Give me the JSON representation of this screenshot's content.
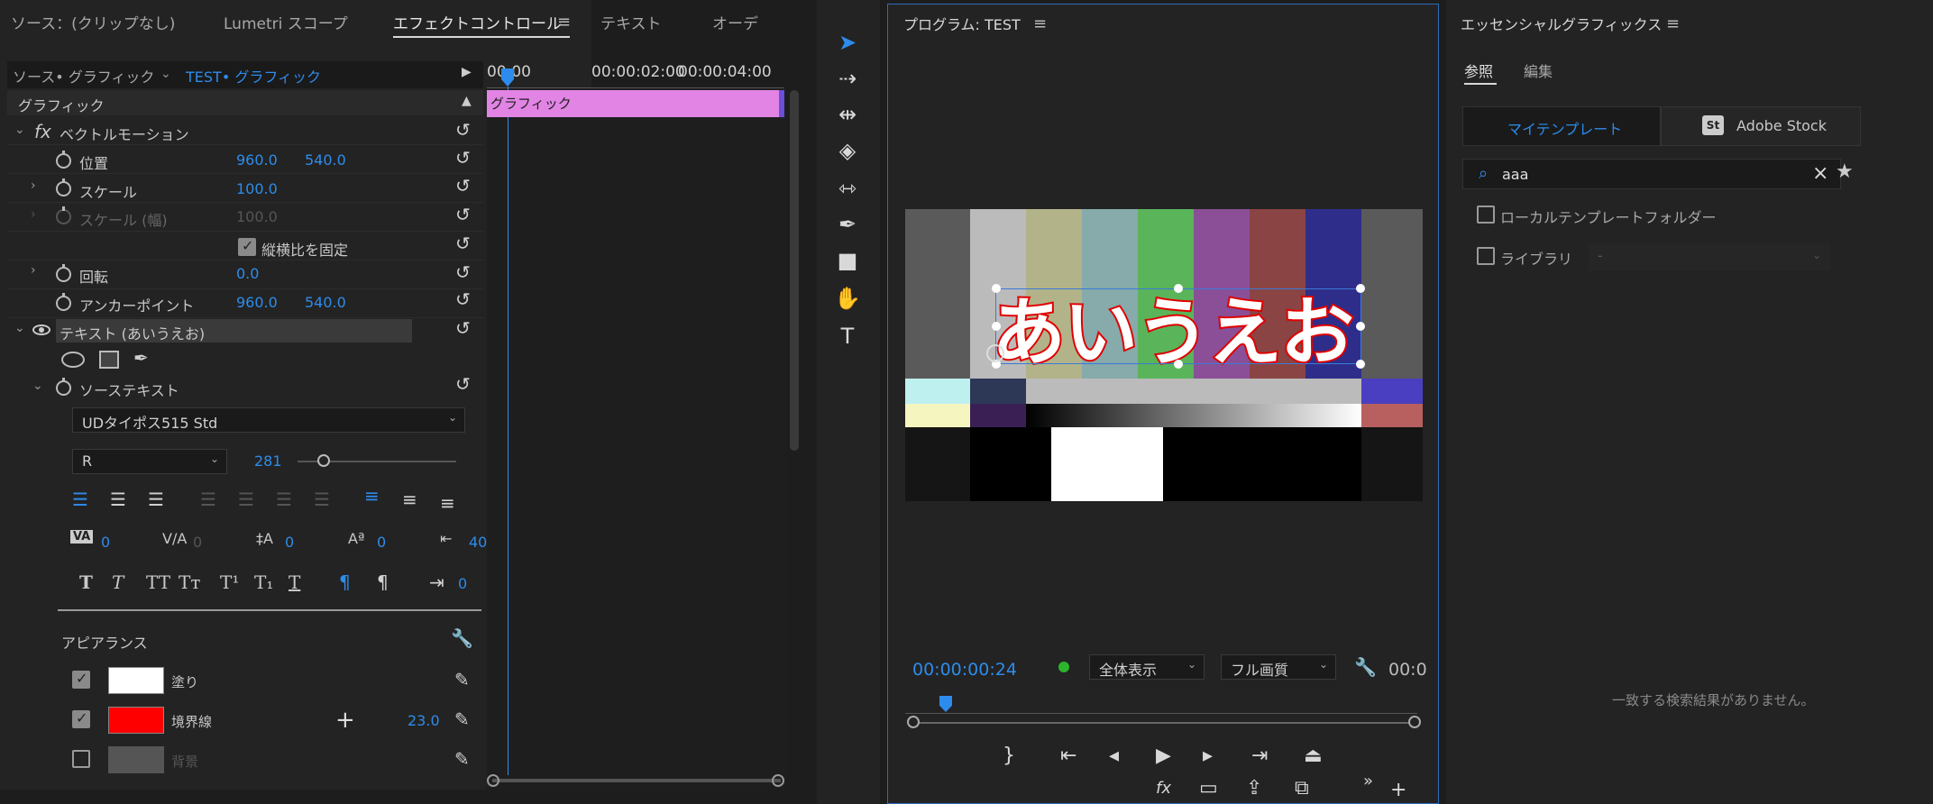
{
  "left_tabs": [
    "ソース：(クリップなし)",
    "Lumetri スコープ",
    "エフェクトコントロール",
    "テキスト",
    "オーデ"
  ],
  "source_bar": {
    "source": "ソース• グラフィック",
    "sequence": "TEST• グラフィック"
  },
  "timecodes": [
    "00:00",
    "00:00:02:00",
    "00:00:04:00"
  ],
  "clip_label": "グラフィック",
  "graphic_header": "グラフィック",
  "vector_motion": {
    "fx": "fx",
    "label": "ベクトルモーション",
    "position_label": "位置",
    "position_x": "960.0",
    "position_y": "540.0",
    "scale_label": "スケール",
    "scale_value": "100.0",
    "scale_w_label": "スケール (幅)",
    "scale_w_value": "100.0",
    "uniform_label": "縦横比を固定",
    "rotation_label": "回転",
    "rotation_value": "0.0",
    "anchor_label": "アンカーポイント",
    "anchor_x": "960.0",
    "anchor_y": "540.0"
  },
  "text_layer": {
    "label": "テキスト (あいうえお)",
    "source_text_label": "ソーステキスト",
    "font": "UDタイポス515 Std",
    "style": "R",
    "size": "281",
    "tracking": "0",
    "kerning": "0",
    "leading": "0",
    "baseline": "0",
    "tsume": "40",
    "tab_value": "0",
    "style_buttons": [
      "T",
      "T",
      "TT",
      "Tт",
      "T¹",
      "T₁",
      "T"
    ]
  },
  "appearance": {
    "label": "アピアランス",
    "fill_label": "塗り",
    "fill_color": "#ffffff",
    "stroke_label": "境界線",
    "stroke_color": "#ff0000",
    "stroke_width": "23.0",
    "bg_label": "背景"
  },
  "program": {
    "title": "プログラム: TEST",
    "timecode": "00:00:00:24",
    "zoom": "全体表示",
    "quality": "フル画質",
    "timecode_right": "00:0",
    "overlay_text": "あいうえお"
  },
  "essential": {
    "title": "エッセンシャルグラフィックス",
    "tab_browse": "参照",
    "tab_edit": "編集",
    "my_templates": "マイテンプレート",
    "adobe_stock": "Adobe Stock",
    "stock_badge": "St",
    "search_value": "aaa",
    "local_folder": "ローカルテンプレートフォルダー",
    "library": "ライブラリ",
    "library_value": "-",
    "no_results": "一致する検索結果がありません。"
  }
}
